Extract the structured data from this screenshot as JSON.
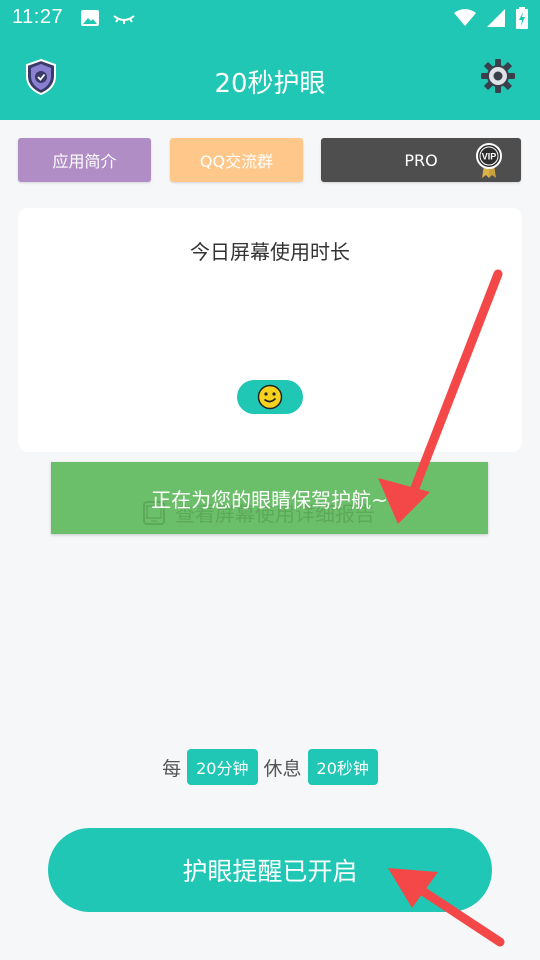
{
  "status_bar": {
    "time": "11:27",
    "icons": [
      "image-icon",
      "eye-closed-icon",
      "wifi-icon",
      "signal-icon",
      "battery-charging-icon"
    ]
  },
  "app_bar": {
    "title": "20秒护眼",
    "left_icon": "shield-check-icon",
    "right_icon": "gear-icon"
  },
  "top_buttons": {
    "intro_label": "应用简介",
    "qq_label": "QQ交流群",
    "pro_label": "PRO",
    "pro_badge": "VIP"
  },
  "usage_card": {
    "title": "今日屏幕使用时长",
    "emoji": "🙂"
  },
  "report_button": {
    "label": "查看屏幕使用详细报告",
    "overlay_text": "正在为您的眼睛保驾护航~"
  },
  "schedule": {
    "prefix": "每",
    "interval": "20分钟",
    "middle": "休息",
    "rest": "20秒钟"
  },
  "main_toggle": {
    "label": "护眼提醒已开启"
  },
  "colors": {
    "primary": "#1fc7b4",
    "intro": "#b08dc4",
    "qq": "#ffc88a",
    "pro": "#4e4e4e",
    "report": "#6cbf6a",
    "arrow": "#f44848"
  }
}
